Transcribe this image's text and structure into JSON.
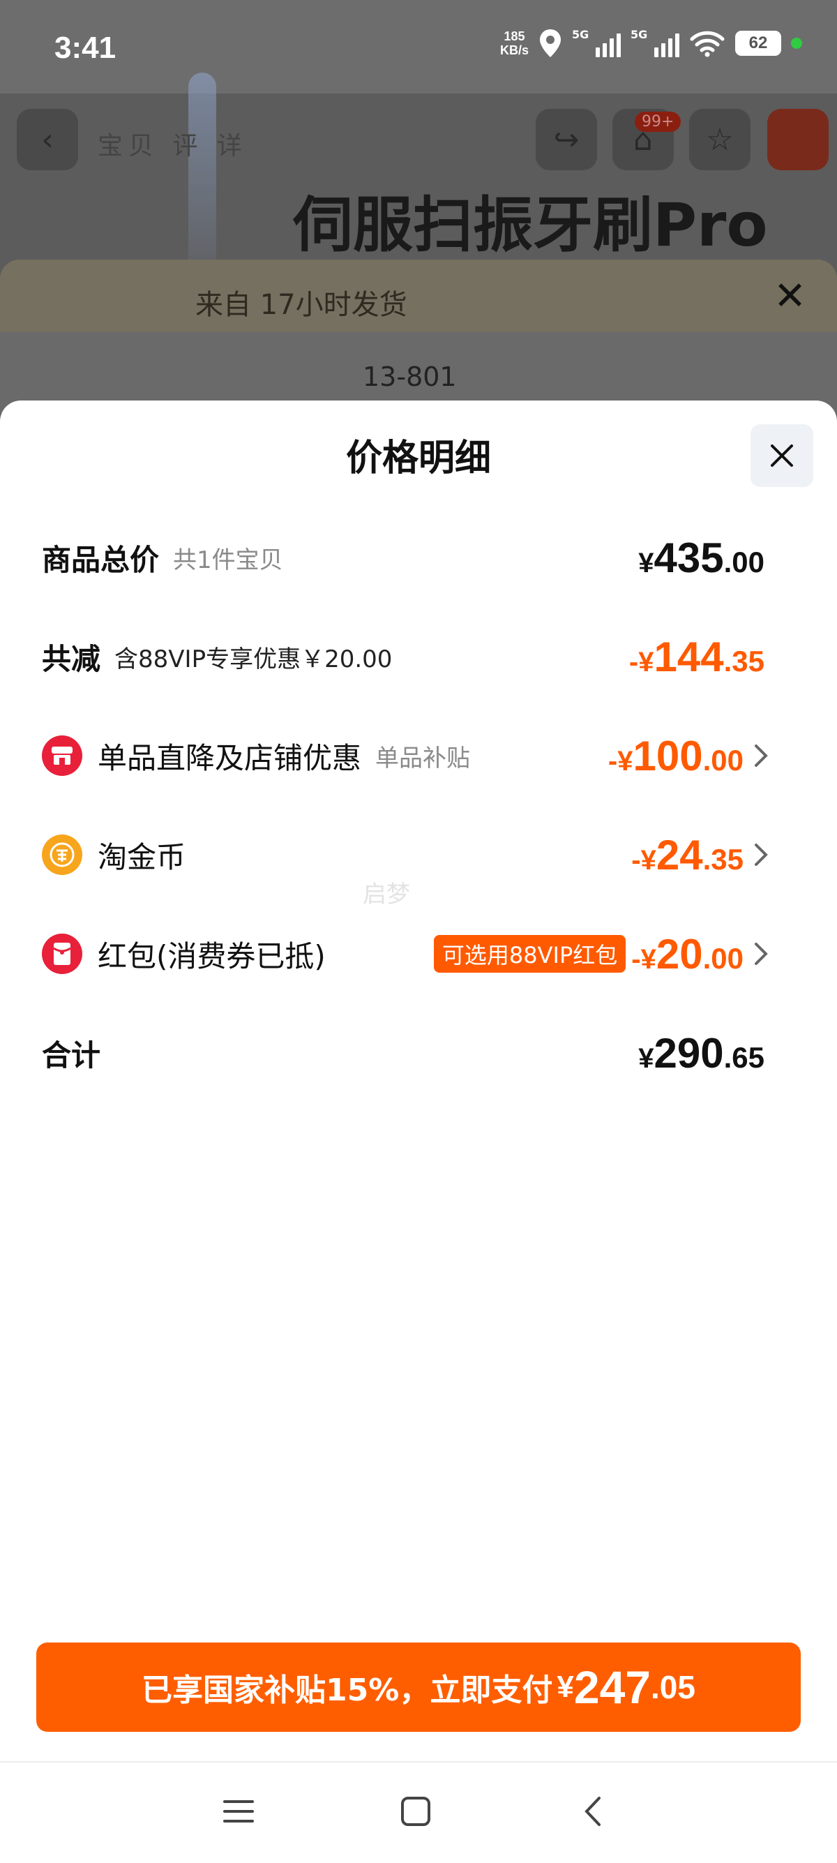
{
  "status_bar": {
    "time": "3:41",
    "net_speed_value": "185",
    "net_speed_unit": "KB/s",
    "signal1": "5G",
    "signal2": "5G",
    "battery": "62"
  },
  "background": {
    "tabs": "宝贝  评  详",
    "cart_badge": "99+",
    "product_title": "伺服扫振牙刷Pro",
    "notice_text": "来自          17小时发货",
    "address": "13-801"
  },
  "sheet": {
    "title": "价格明细",
    "rows": [
      {
        "label": "商品总价",
        "sub": "共1件宝贝",
        "currency": "¥",
        "int": "435",
        "dec": ".00"
      },
      {
        "label": "共减",
        "sub": "含88VIP专享优惠￥20.00",
        "prefix": "-",
        "currency": "¥",
        "int": "144",
        "dec": ".35"
      },
      {
        "label": "单品直降及店铺优惠",
        "sub": "单品补贴",
        "icon": "store-icon",
        "prefix": "-",
        "currency": "¥",
        "int": "100",
        "dec": ".00"
      },
      {
        "label": "淘金币",
        "icon": "coin-icon",
        "prefix": "-",
        "currency": "¥",
        "int": "24",
        "dec": ".35"
      },
      {
        "label": "红包(消费券已抵)",
        "icon": "red-packet-icon",
        "tag": "可选用88VIP红包",
        "prefix": "-",
        "currency": "¥",
        "int": "20",
        "dec": ".00"
      },
      {
        "label": "合计",
        "currency": "¥",
        "int": "290",
        "dec": ".65"
      }
    ],
    "watermark": "启梦"
  },
  "pay_button": {
    "text": "已享国家补贴15%，立即支付",
    "currency": "¥",
    "int": "247",
    "dec": ".05"
  },
  "colors": {
    "accent": "#ff5a00",
    "store_icon": "#e8203a",
    "coin_icon": "#f7a51c",
    "red_packet_icon": "#e8203a"
  }
}
